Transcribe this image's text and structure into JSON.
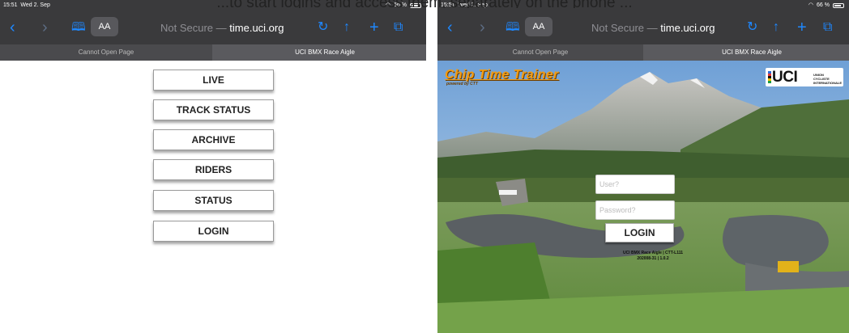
{
  "caption": "...to start logins and access them, separately on the phone ...",
  "left": {
    "status": {
      "time": "15:51",
      "date": "Wed 2. Sep",
      "battery": "66 %"
    },
    "toolbar": {
      "aa": "AA",
      "url_prefix": "Not Secure —",
      "url_host": "time.uci.org"
    },
    "tabs": [
      {
        "label": "Cannot Open Page"
      },
      {
        "label": "UCI BMX Race Aigle"
      }
    ],
    "menu": [
      "LIVE",
      "TRACK STATUS",
      "ARCHIVE",
      "RIDERS",
      "STATUS",
      "LOGIN"
    ]
  },
  "right": {
    "status": {
      "time": "15:51",
      "date": "Wed 2. Sep",
      "battery": "66 %"
    },
    "toolbar": {
      "aa": "AA",
      "url_prefix": "Not Secure —",
      "url_host": "time.uci.org"
    },
    "tabs": [
      {
        "label": "Cannot Open Page"
      },
      {
        "label": "UCI BMX Race Aigle"
      }
    ],
    "brand": {
      "ctt": "Chip Time Trainer",
      "ctt_sub": "powered by CTT",
      "uci": "UCI",
      "uci_tag1": "UNION",
      "uci_tag2": "CYCLISTE",
      "uci_tag3": "INTERNATIONALE"
    },
    "login": {
      "user_placeholder": "User?",
      "password_placeholder": "Password?",
      "button": "LOGIN",
      "footer1": "UCI BMX Race Aigle | CTT-L111",
      "footer2": "202008-31 | 1.0.2"
    }
  },
  "colors": {
    "chrome": "#3a3a3c",
    "accent_blue": "#1e88ff",
    "ctt_orange": "#f39c12"
  }
}
